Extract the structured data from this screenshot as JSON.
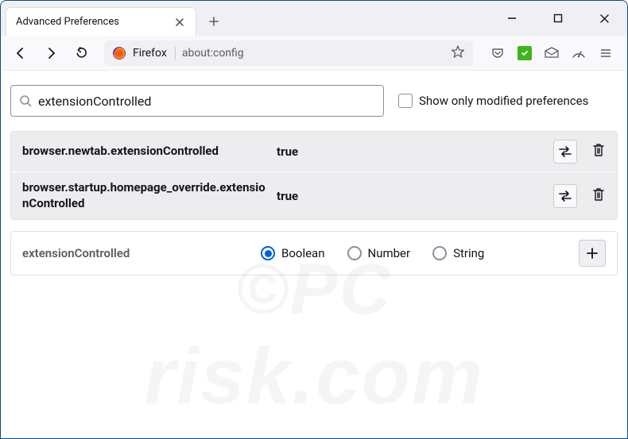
{
  "window": {
    "tab_title": "Advanced Preferences"
  },
  "urlbar": {
    "identity": "Firefox",
    "url": "about:config"
  },
  "search": {
    "value": "extensionControlled"
  },
  "modified_only": {
    "label": "Show only modified preferences"
  },
  "prefs": {
    "row1_name": "browser.newtab.extensionControlled",
    "row1_value": "true",
    "row2_name": "browser.startup.homepage_override.extensionControlled",
    "row2_value": "true"
  },
  "new_pref": {
    "name": "extensionControlled",
    "opt_boolean": "Boolean",
    "opt_number": "Number",
    "opt_string": "String"
  },
  "watermark": {
    "line1": "©PC",
    "line2": "risk.com"
  }
}
